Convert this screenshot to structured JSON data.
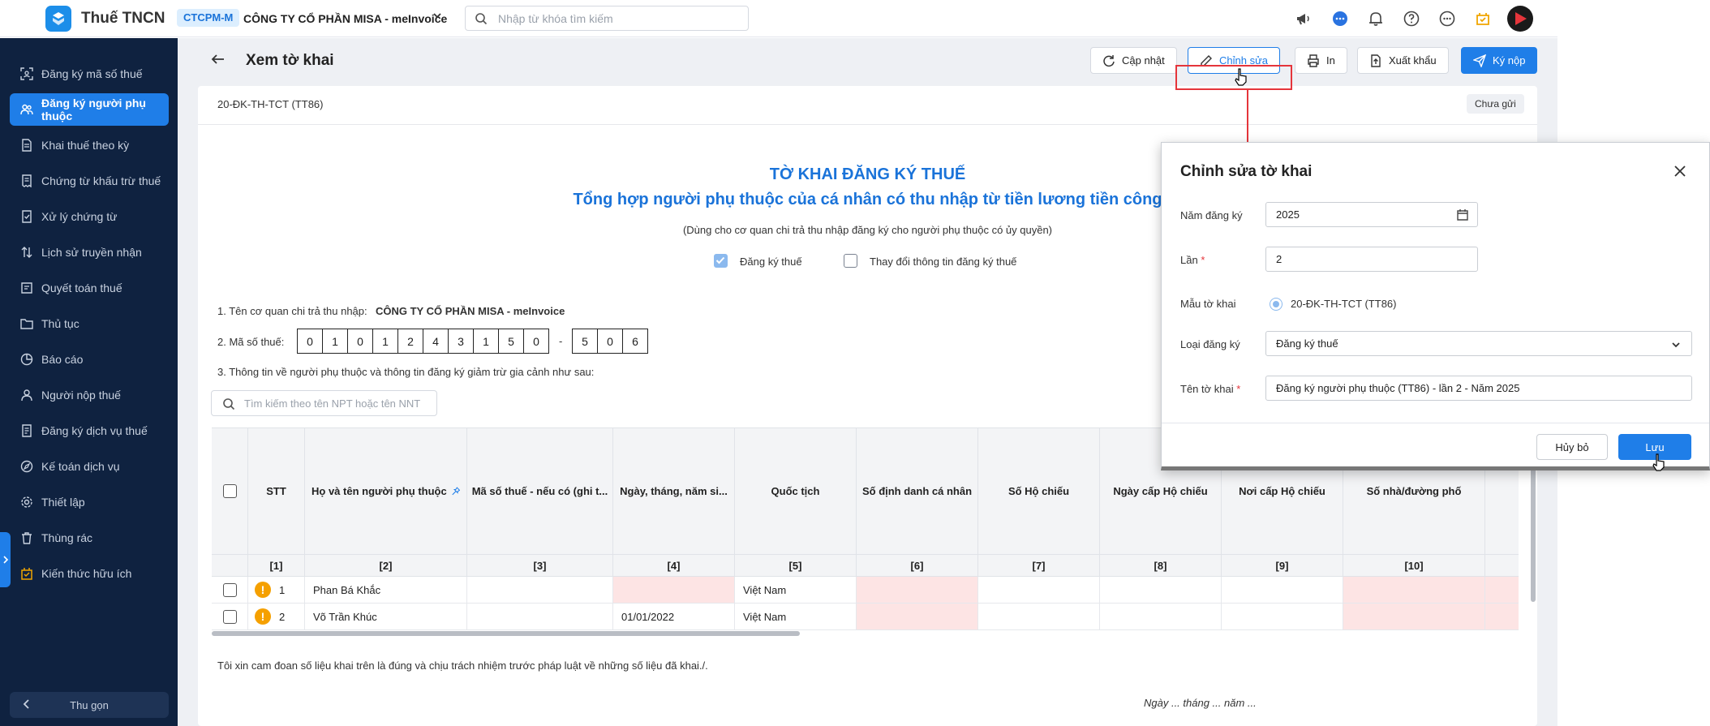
{
  "app": {
    "name": "Thuế TNCN"
  },
  "topbar": {
    "company_tag": "CTCPM-M",
    "company_name": "CÔNG TY CỔ PHẦN MISA - meInvoice",
    "search_placeholder": "Nhập từ khóa tìm kiếm"
  },
  "sidebar": {
    "items": [
      {
        "label": "Đăng ký mã số thuế",
        "icon": "id-scan-icon"
      },
      {
        "label": "Đăng ký người phụ thuộc",
        "icon": "users-icon",
        "active": true
      },
      {
        "label": "Khai thuế theo kỳ",
        "icon": "document-icon"
      },
      {
        "label": "Chứng từ khấu trừ thuế",
        "icon": "receipt-icon"
      },
      {
        "label": "Xử lý chứng từ",
        "icon": "process-doc-icon"
      },
      {
        "label": "Lịch sử truyền nhận",
        "icon": "sort-arrows-icon"
      },
      {
        "label": "Quyết toán thuế",
        "icon": "settlement-icon"
      },
      {
        "label": "Thủ tục",
        "icon": "folder-icon"
      },
      {
        "label": "Báo cáo",
        "icon": "pie-chart-icon"
      },
      {
        "label": "Người nộp thuế",
        "icon": "person-icon"
      },
      {
        "label": "Đăng ký dịch vụ thuế",
        "icon": "service-icon"
      },
      {
        "label": "Kế toán dịch vụ",
        "icon": "compass-icon"
      },
      {
        "label": "Thiết lập",
        "icon": "gear-icon"
      },
      {
        "label": "Thùng rác",
        "icon": "trash-icon"
      },
      {
        "label": "Kiến thức hữu ích",
        "icon": "knowledge-icon"
      }
    ],
    "collapse_label": "Thu gọn"
  },
  "page": {
    "title": "Xem tờ khai",
    "toolbar": {
      "update": "Cập nhật",
      "edit": "Chỉnh sửa",
      "print": "In",
      "export": "Xuất khẩu",
      "submit": "Ký nộp"
    },
    "form_code": "20-ĐK-TH-TCT (TT86)",
    "status": "Chưa gửi"
  },
  "document": {
    "title": "TỜ KHAI ĐĂNG KÝ THUẾ",
    "subtitle": "Tổng hợp người phụ thuộc của cá nhân có thu nhập từ tiền lương tiền công",
    "note": "(Dùng cho cơ quan chi trả thu nhập đăng ký cho người phụ thuộc có ủy quyền)",
    "checkbox_register": "Đăng ký thuế",
    "checkbox_change": "Thay đổi thông tin đăng ký thuế",
    "line1_label": "1. Tên cơ quan chi trả thu nhập:",
    "line1_value": "CÔNG TY CỔ PHẦN MISA - meInvoice",
    "line2_label": "2. Mã số thuế:",
    "tax_digits": [
      "0",
      "1",
      "0",
      "1",
      "2",
      "4",
      "3",
      "1",
      "5",
      "0"
    ],
    "tax_dash": "-",
    "tax_suffix": [
      "5",
      "0",
      "6"
    ],
    "line3_label": "3. Thông tin về người phụ thuộc và thông tin đăng ký giảm trừ gia cảnh như sau:",
    "search_placeholder": "Tìm kiếm theo tên NPT hoặc tên NNT",
    "commitment": "Tôi xin cam đoan số liệu khai trên là đúng và chịu trách nhiệm trước pháp luật về những số liệu đã khai./.",
    "date_line": "Ngày ... tháng ... năm ..."
  },
  "table": {
    "headers": [
      "STT",
      "Họ và tên người phụ thuộc",
      "Mã số thuế - nếu có (ghi t...",
      "Ngày, tháng, năm si...",
      "Quốc tịch",
      "Số định danh cá nhân",
      "Số Hộ chiếu",
      "Ngày cấp Hộ chiếu",
      "Nơi cấp Hộ chiếu",
      "Số nhà/đường phố"
    ],
    "numbers": [
      "[1]",
      "[2]",
      "[3]",
      "[4]",
      "[5]",
      "[6]",
      "[7]",
      "[8]",
      "[9]",
      "[10]"
    ],
    "rows": [
      {
        "stt": "1",
        "name": "Phan Bá Khắc",
        "tax": "",
        "dob": "",
        "nationality": "Việt Nam"
      },
      {
        "stt": "2",
        "name": "Võ Trần Khúc",
        "tax": "",
        "dob": "01/01/2022",
        "nationality": "Việt Nam"
      }
    ]
  },
  "dialog": {
    "title": "Chỉnh sửa tờ khai",
    "year_label": "Năm đăng ký",
    "year_value": "2025",
    "times_label": "Lần",
    "times_value": "2",
    "template_label": "Mẫu tờ khai",
    "template_value": "20-ĐK-TH-TCT (TT86)",
    "type_label": "Loại đăng ký",
    "type_value": "Đăng ký thuế",
    "name_label": "Tên tờ khai",
    "name_value": "Đăng ký người phụ thuộc (TT86) - lần 2 - Năm 2025",
    "cancel": "Hủy bỏ",
    "save": "Lưu"
  },
  "colors": {
    "accent": "#1f7ee8",
    "sidebar": "#0f2240",
    "highlight": "#e5353b",
    "error_cell": "#fde4e4",
    "warning": "#f5a000"
  }
}
